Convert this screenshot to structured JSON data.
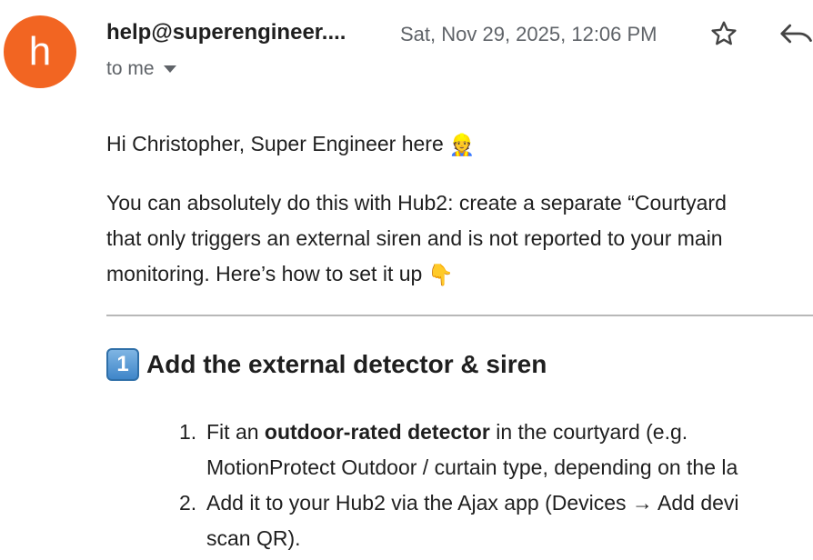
{
  "header": {
    "avatar_letter": "h",
    "avatar_color": "#f26522",
    "sender": "help@superengineer....",
    "date": "Sat, Nov 29, 2025, 12:06 PM",
    "recipient": "to me"
  },
  "icons": {
    "star": "star-outline-icon",
    "reply": "reply-arrow-icon",
    "dropdown": "caret-down-icon"
  },
  "body": {
    "greeting": "Hi Christopher, Super Engineer here",
    "greeting_emoji": "👷",
    "para_line1": "You can absolutely do this with Hub2: create a separate “Courtyard",
    "para_line2": "that only triggers an external siren and is not reported to your main",
    "para_line3": "monitoring. Here’s how to set it up",
    "para_emoji": "👇"
  },
  "section1": {
    "keycap": "1",
    "title": "Add the external detector & siren",
    "items": [
      {
        "number": "1.",
        "pre": "Fit an ",
        "bold": "outdoor-rated detector",
        "post": " in the courtyard (e.g.",
        "cont": "MotionProtect Outdoor / curtain type, depending on the la"
      },
      {
        "number": "2.",
        "text": "Add it to your Hub2 via the Ajax app (Devices → Add devi",
        "cont": "scan QR)."
      }
    ]
  }
}
